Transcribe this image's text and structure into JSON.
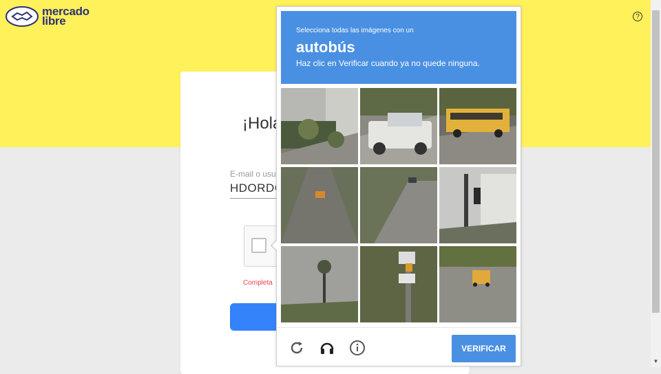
{
  "brand": {
    "name_line1": "mercado",
    "name_line2": "libre"
  },
  "header": {
    "help_icon": "?"
  },
  "login": {
    "greeting": "¡Hola",
    "email_label": "E-mail o usu",
    "email_value": "HDORDG",
    "error_text": "Completa"
  },
  "captcha": {
    "instruction_small": "Selecciona todas las imágenes con un",
    "target_word": "autobús",
    "instruction_sub": "Haz clic en Verificar cuando ya no quede ninguna.",
    "verify_label": "VERIFICAR",
    "tiles": [
      {
        "scene": "house with steps and hedges"
      },
      {
        "scene": "white pickup truck"
      },
      {
        "scene": "yellow school bus on road"
      },
      {
        "scene": "road with small vehicle"
      },
      {
        "scene": "road with car"
      },
      {
        "scene": "traffic light by building"
      },
      {
        "scene": "palm tree"
      },
      {
        "scene": "street signs on pole"
      },
      {
        "scene": "yellow school bus on road"
      }
    ],
    "icons": [
      "reload-icon",
      "headphones-icon",
      "info-icon"
    ]
  },
  "colors": {
    "brand_yellow": "#fff159",
    "captcha_blue": "#4a90e2",
    "continue_blue": "#3483fa",
    "error_red": "#f23d4f"
  }
}
